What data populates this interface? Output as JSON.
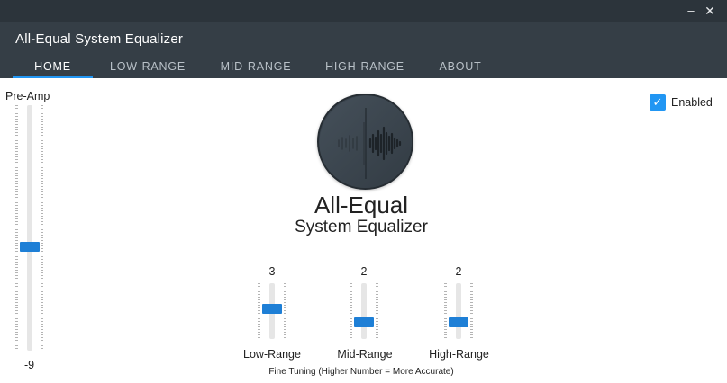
{
  "window": {
    "title": "All-Equal System Equalizer",
    "minimize_glyph": "–",
    "close_glyph": "✕"
  },
  "tabs": [
    {
      "label": "HOME",
      "active": true
    },
    {
      "label": "LOW-RANGE",
      "active": false
    },
    {
      "label": "MID-RANGE",
      "active": false
    },
    {
      "label": "HIGH-RANGE",
      "active": false
    },
    {
      "label": "ABOUT",
      "active": false
    }
  ],
  "preamp": {
    "label": "Pre-Amp",
    "value": "-9",
    "level": 0.42
  },
  "logo": {
    "title": "All-Equal",
    "subtitle": "System Equalizer",
    "icon": "sound-wave-icon"
  },
  "enabled": {
    "label": "Enabled",
    "checked": true
  },
  "fine_tuning": {
    "caption": "Fine Tuning (Higher Number = More Accurate)",
    "sliders": [
      {
        "label": "Low-Range",
        "value": "3",
        "level": 0.55
      },
      {
        "label": "Mid-Range",
        "value": "2",
        "level": 0.25
      },
      {
        "label": "High-Range",
        "value": "2",
        "level": 0.25
      }
    ]
  },
  "colors": {
    "titlebar": "#2c343b",
    "header": "#353e46",
    "accent": "#2196f3",
    "thumb": "#1e7fd6"
  }
}
